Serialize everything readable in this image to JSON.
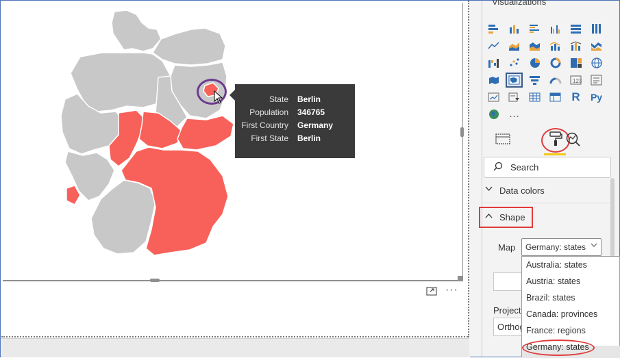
{
  "pane": {
    "title": "Visualizations",
    "more_glyph": "…",
    "search_placeholder": "Search",
    "sections": {
      "data_colors": "Data colors",
      "shape": "Shape"
    },
    "map_label": "Map",
    "map_value": "Germany: states",
    "projection_label": "Projection",
    "projection_value": "Orthographic",
    "dropdown_options": [
      "Australia: states",
      "Austria: states",
      "Brazil: states",
      "Canada: provinces",
      "France: regions",
      "Germany: states"
    ]
  },
  "tooltip": {
    "rows": [
      {
        "key": "State",
        "value": "Berlin"
      },
      {
        "key": "Population",
        "value": "346765"
      },
      {
        "key": "First Country",
        "value": "Germany"
      },
      {
        "key": "First State",
        "value": "Berlin"
      }
    ]
  },
  "visual": {
    "more_glyph": "···"
  },
  "colors": {
    "highlight": "#f8615a",
    "base_state": "#c8c8c8",
    "tooltip_bg": "#3a3a3a",
    "annotation_red": "#e03a3a",
    "annotation_purple": "#6c3a91"
  }
}
